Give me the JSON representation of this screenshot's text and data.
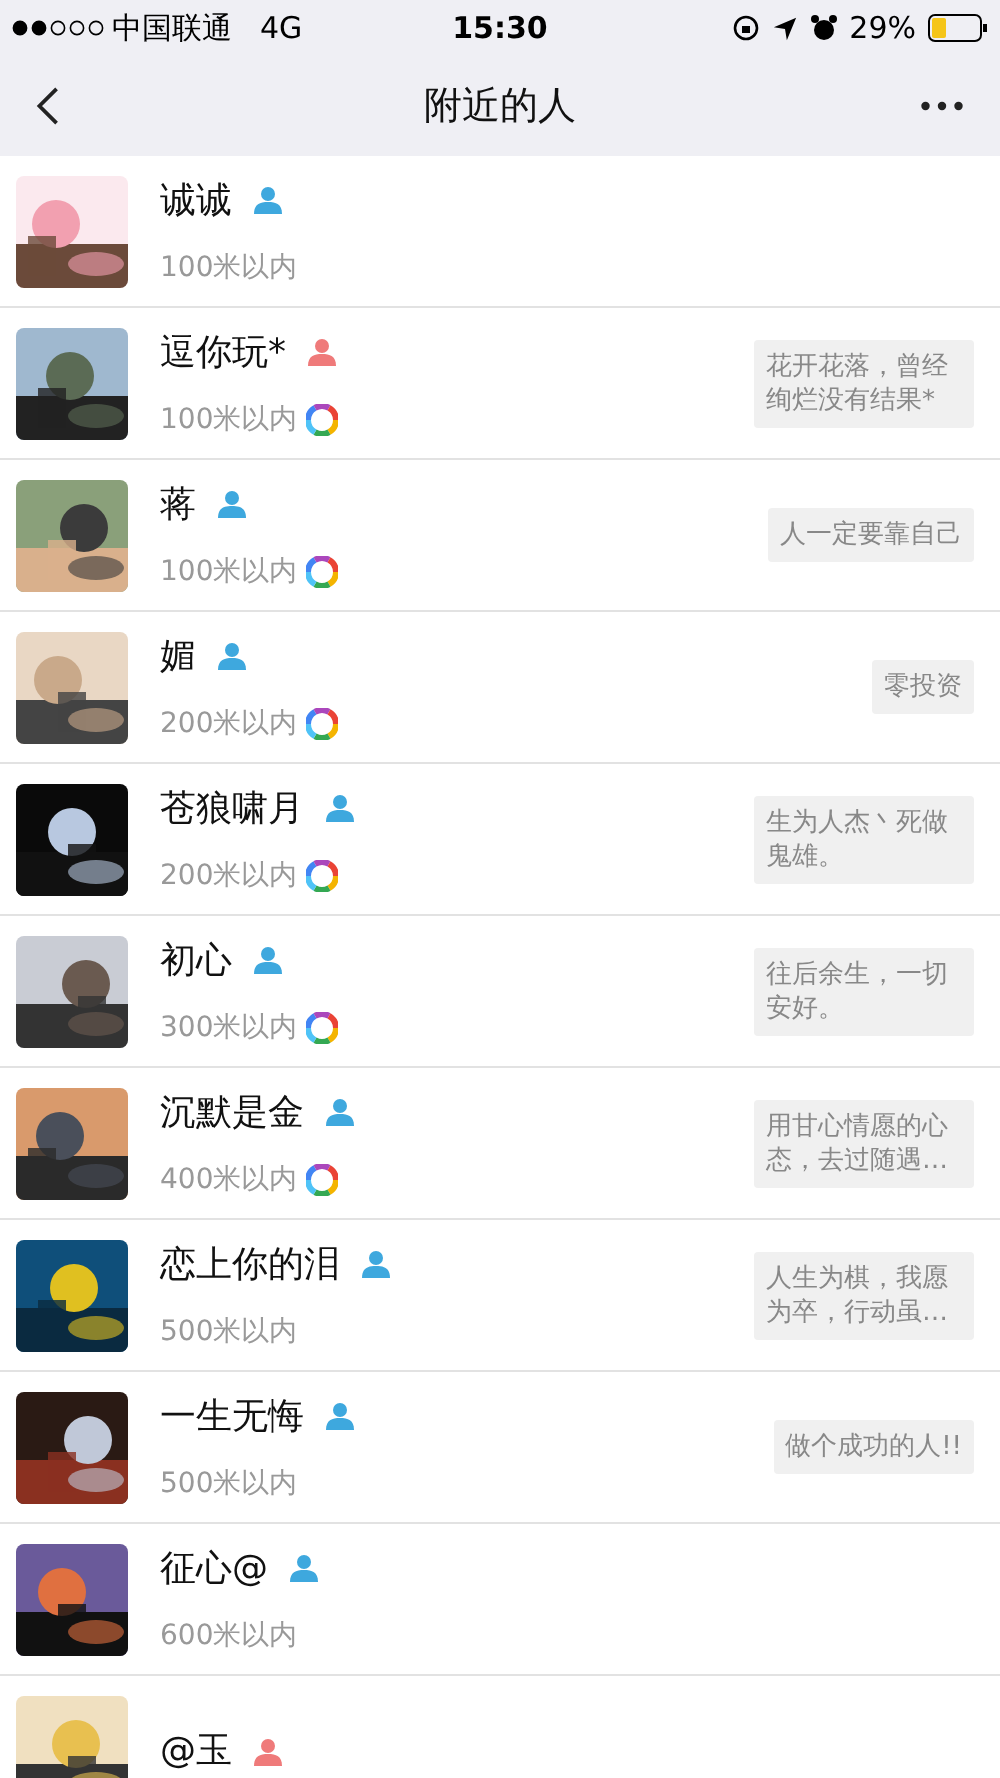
{
  "status_bar": {
    "carrier": "中国联通",
    "network": "4G",
    "time": "15:30",
    "battery": "29%"
  },
  "nav": {
    "title": "附近的人"
  },
  "people": [
    {
      "name": "诚诚",
      "color": "#3ea8de",
      "distance": "100米以内",
      "moments": false
    },
    {
      "name": "逗你玩*",
      "color": "#ef7a7a",
      "distance": "100米以内",
      "moments": true,
      "signature": "花开花落，曾经绚烂没有结果*"
    },
    {
      "name": "蒋",
      "color": "#3ea8de",
      "distance": "100米以内",
      "moments": true,
      "signature": "人一定要靠自己"
    },
    {
      "name": "媚",
      "color": "#3ea8de",
      "distance": "200米以内",
      "moments": true,
      "signature": "零投资"
    },
    {
      "name": "苍狼啸月",
      "color": "#3ea8de",
      "distance": "200米以内",
      "moments": true,
      "signature": "生为人杰丶死做鬼雄。"
    },
    {
      "name": "初心",
      "color": "#3ea8de",
      "distance": "300米以内",
      "moments": true,
      "signature": "往后余生，一切安好。"
    },
    {
      "name": "沉默是金",
      "color": "#3ea8de",
      "distance": "400米以内",
      "moments": true,
      "signature": "用甘心情愿的心态，去过随遇…"
    },
    {
      "name": "恋上你的泪",
      "color": "#3ea8de",
      "distance": "500米以内",
      "moments": false,
      "signature": "人生为棋，我愿为卒，行动虽…"
    },
    {
      "name": "一生无悔",
      "color": "#3ea8de",
      "distance": "500米以内",
      "moments": false,
      "signature": "做个成功的人!!"
    },
    {
      "name": "征心@",
      "color": "#3ea8de",
      "distance": "600米以内",
      "moments": false
    },
    {
      "name": "@玉",
      "color": "#ef7a7a"
    }
  ]
}
